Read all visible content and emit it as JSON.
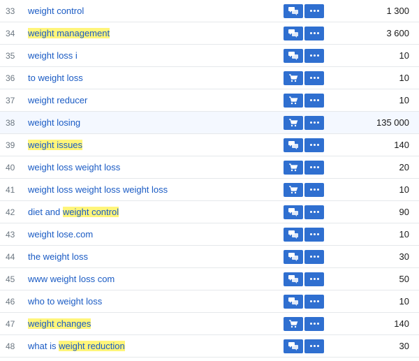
{
  "icons": {
    "chat": "chat-icon",
    "cart": "cart-icon",
    "more": "more-icon"
  },
  "rows": [
    {
      "num": "33",
      "keyword": "weight control",
      "highlight_parts": [],
      "icon": "chat",
      "volume": "1 300",
      "hovered": false
    },
    {
      "num": "34",
      "keyword": "weight management",
      "highlight_parts": [
        [
          0,
          17
        ]
      ],
      "icon": "chat",
      "volume": "3 600",
      "hovered": false
    },
    {
      "num": "35",
      "keyword": "weight loss i",
      "highlight_parts": [],
      "icon": "chat",
      "volume": "10",
      "hovered": false
    },
    {
      "num": "36",
      "keyword": "to weight loss",
      "highlight_parts": [],
      "icon": "cart",
      "volume": "10",
      "hovered": false
    },
    {
      "num": "37",
      "keyword": "weight reducer",
      "highlight_parts": [],
      "icon": "cart",
      "volume": "10",
      "hovered": false
    },
    {
      "num": "38",
      "keyword": "weight losing",
      "highlight_parts": [],
      "icon": "cart",
      "volume": "135 000",
      "hovered": true
    },
    {
      "num": "39",
      "keyword": "weight issues",
      "highlight_parts": [
        [
          0,
          13
        ]
      ],
      "icon": "chat",
      "volume": "140",
      "hovered": false
    },
    {
      "num": "40",
      "keyword": "weight loss weight loss",
      "highlight_parts": [],
      "icon": "cart",
      "volume": "20",
      "hovered": false
    },
    {
      "num": "41",
      "keyword": "weight loss weight loss weight loss",
      "highlight_parts": [],
      "icon": "cart",
      "volume": "10",
      "hovered": false
    },
    {
      "num": "42",
      "keyword": "diet and weight control",
      "highlight_parts": [
        [
          9,
          23
        ]
      ],
      "icon": "chat",
      "volume": "90",
      "hovered": false
    },
    {
      "num": "43",
      "keyword": "weight lose.com",
      "highlight_parts": [],
      "icon": "chat",
      "volume": "10",
      "hovered": false
    },
    {
      "num": "44",
      "keyword": "the weight loss",
      "highlight_parts": [],
      "icon": "chat",
      "volume": "30",
      "hovered": false
    },
    {
      "num": "45",
      "keyword": "www weight loss com",
      "highlight_parts": [],
      "icon": "chat",
      "volume": "50",
      "hovered": false
    },
    {
      "num": "46",
      "keyword": "who to weight loss",
      "highlight_parts": [],
      "icon": "chat",
      "volume": "10",
      "hovered": false
    },
    {
      "num": "47",
      "keyword": "weight changes",
      "highlight_parts": [
        [
          0,
          14
        ]
      ],
      "icon": "cart",
      "volume": "140",
      "hovered": false
    },
    {
      "num": "48",
      "keyword": "what is weight reduction",
      "highlight_parts": [
        [
          8,
          24
        ]
      ],
      "icon": "chat",
      "volume": "30",
      "hovered": false
    }
  ]
}
